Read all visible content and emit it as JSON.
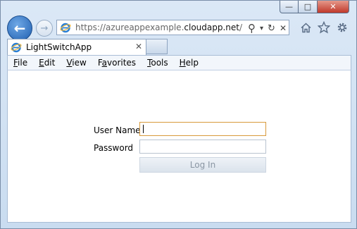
{
  "window": {
    "minimize_glyph": "—",
    "maximize_glyph": "□",
    "close_glyph": "✕"
  },
  "nav": {
    "back_glyph": "←",
    "forward_glyph": "→"
  },
  "address_bar": {
    "url_prefix": "https://azureappexample.",
    "url_domain": "cloudapp.net",
    "url_suffix": "/",
    "search_glyph": "⚲",
    "dropdown_glyph": "▾",
    "refresh_glyph": "↻",
    "stop_glyph": "✕"
  },
  "toolbar_icons": [
    "home-icon",
    "favorites-star-icon",
    "settings-gear-icon"
  ],
  "tab": {
    "title": "LightSwitchApp",
    "close_glyph": "✕"
  },
  "menu": {
    "items": [
      "File",
      "Edit",
      "View",
      "Favorites",
      "Tools",
      "Help"
    ]
  },
  "login": {
    "username_label": "User Name",
    "password_label": "Password",
    "username_value": "",
    "password_value": "",
    "login_button": "Log In"
  },
  "colors": {
    "focus_border": "#d89a3b",
    "back_button": "#1f5fb0"
  }
}
